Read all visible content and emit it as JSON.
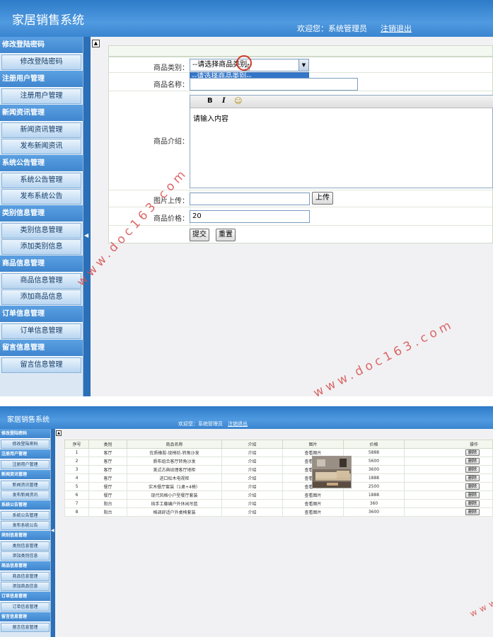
{
  "app_title": "家居销售系统",
  "header": {
    "welcome": "欢迎您：系统管理员",
    "logout": "注销退出"
  },
  "sidebar": {
    "groups": [
      {
        "title": "修改登陆密码",
        "items": [
          "修改登陆密码"
        ]
      },
      {
        "title": "注册用户管理",
        "items": [
          "注册用户管理"
        ]
      },
      {
        "title": "新闻资讯管理",
        "items": [
          "新闻资讯管理",
          "发布新闻资讯"
        ]
      },
      {
        "title": "系统公告管理",
        "items": [
          "系统公告管理",
          "发布系统公告"
        ]
      },
      {
        "title": "类别信息管理",
        "items": [
          "类别信息管理",
          "添加类别信息"
        ]
      },
      {
        "title": "商品信息管理",
        "items": [
          "商品信息管理",
          "添加商品信息"
        ]
      },
      {
        "title": "订单信息管理",
        "items": [
          "订单信息管理"
        ]
      },
      {
        "title": "留言信息管理",
        "items": [
          "留言信息管理"
        ]
      }
    ]
  },
  "form": {
    "category_label": "商品类别：",
    "category_value": "--请选择商品类别--",
    "dropdown_option": "--请选择商品类别--",
    "name_label": "商品名称：",
    "name_value": "",
    "desc_label": "商品介绍：",
    "editor_bold": "B",
    "editor_italic": "I",
    "editor_emoji": "☺",
    "desc_value": "请输入内容",
    "image_label": "图片上传：",
    "upload_button": "上传",
    "price_label": "商品价格：",
    "price_value": "20",
    "submit_button": "提交",
    "reset_button": "重置"
  },
  "table": {
    "headers": [
      "序号",
      "类别",
      "商品名称",
      "介绍",
      "图片",
      "价格",
      "操作"
    ],
    "rows": [
      {
        "no": "1",
        "category": "客厅",
        "name": "优质橡胶-现椅纺-转角沙发",
        "intro": "介绍",
        "image": "查看图片",
        "price": "5888",
        "action": "删除"
      },
      {
        "no": "2",
        "category": "客厅",
        "name": "质布组合客厅转角沙发",
        "intro": "介绍",
        "image": "查看图片",
        "price": "5600",
        "action": "删除"
      },
      {
        "no": "3",
        "category": "客厅",
        "name": "美式古典纹理客厅地柜",
        "intro": "介绍",
        "image": "查看图片",
        "price": "3600",
        "action": "删除"
      },
      {
        "no": "4",
        "category": "客厅",
        "name": "进口松木电视柜",
        "intro": "介绍",
        "image": "查看图片",
        "price": "1888",
        "action": "删除"
      },
      {
        "no": "5",
        "category": "餐厅",
        "name": "实木餐厅套装（1桌+4椅）",
        "intro": "介绍",
        "image": "查看图片",
        "price": "2500",
        "action": "删除"
      },
      {
        "no": "6",
        "category": "餐厅",
        "name": "现代风格小户型餐厅套装",
        "intro": "介绍",
        "image": "查看图片",
        "price": "1888",
        "action": "删除"
      },
      {
        "no": "7",
        "category": "阳台",
        "name": "纯手工藤编户外休闲吊篮",
        "intro": "介绍",
        "image": "查看图片",
        "price": "360",
        "action": "删除"
      },
      {
        "no": "8",
        "category": "阳台",
        "name": "格调舒适户外桌椅套装",
        "intro": "介绍",
        "image": "查看图片",
        "price": "3600",
        "action": "删除"
      }
    ]
  },
  "watermark": "www.doc163.com",
  "colors": {
    "header_blue": "#3a85cf",
    "accent": "#2a6fb8",
    "watermark": "#d64e4e"
  },
  "icons": [
    "collapse-toggle-icon",
    "dropdown-arrow-icon",
    "hand-cursor-icon",
    "emoji-icon",
    "sidebar-collapse-arrow-icon"
  ]
}
